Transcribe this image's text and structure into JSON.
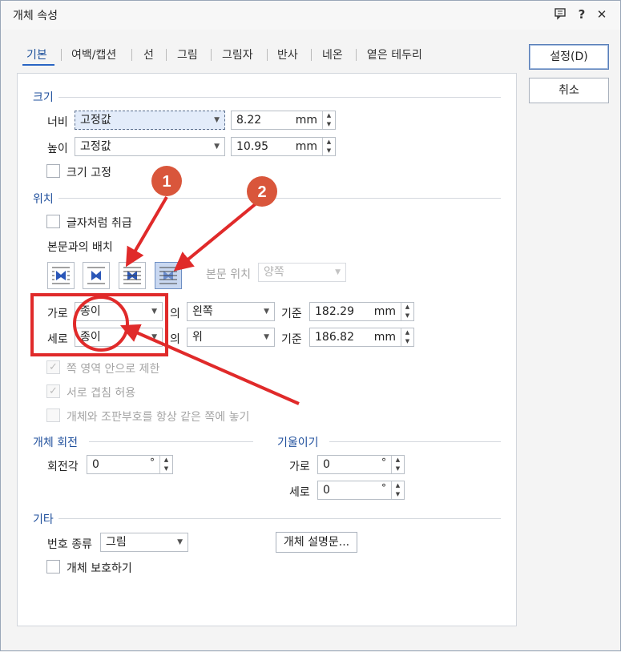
{
  "window": {
    "title": "개체 속성"
  },
  "tabs": [
    "기본",
    "여백/캡션",
    "선",
    "그림",
    "그림자",
    "반사",
    "네온",
    "옅은 테두리"
  ],
  "buttons": {
    "ok": "설정(D)",
    "cancel": "취소"
  },
  "size": {
    "title": "크기",
    "width_label": "너비",
    "width_mode": "고정값",
    "width_value": "8.22",
    "width_unit": "mm",
    "height_label": "높이",
    "height_mode": "고정값",
    "height_value": "10.95",
    "height_unit": "mm",
    "fix_label": "크기 고정"
  },
  "position": {
    "title": "위치",
    "treat_as_char": "글자처럼 취급",
    "wrap_label": "본문과의 배치",
    "body_pos_label": "본문 위치",
    "body_pos_value": "양쪽",
    "horiz_label": "가로",
    "horiz_ref": "종이",
    "of1": "의",
    "horiz_align": "왼쪽",
    "base1": "기준",
    "horiz_value": "182.29",
    "horiz_unit": "mm",
    "vert_label": "세로",
    "vert_ref": "종이",
    "of2": "의",
    "vert_align": "위",
    "base2": "기준",
    "vert_value": "186.82",
    "vert_unit": "mm",
    "limit_label": "쪽 영역 안으로 제한",
    "overlap_label": "서로 겹침 허용",
    "same_page_label": "개체와 조판부호를 항상 같은 쪽에 놓기"
  },
  "rotation": {
    "title": "개체 회전",
    "angle_label": "회전각",
    "angle_value": "0",
    "angle_unit": "°"
  },
  "skew": {
    "title": "기울이기",
    "h_label": "가로",
    "h_value": "0",
    "h_unit": "°",
    "v_label": "세로",
    "v_value": "0",
    "v_unit": "°"
  },
  "misc": {
    "title": "기타",
    "number_type_label": "번호 종류",
    "number_type_value": "그림",
    "describe_button": "개체 설명문...",
    "protect_label": "개체 보호하기"
  },
  "annotations": {
    "marker1": "1",
    "marker2": "2",
    "accent_color": "#e02a2a",
    "marker_color": "#d9563b"
  }
}
